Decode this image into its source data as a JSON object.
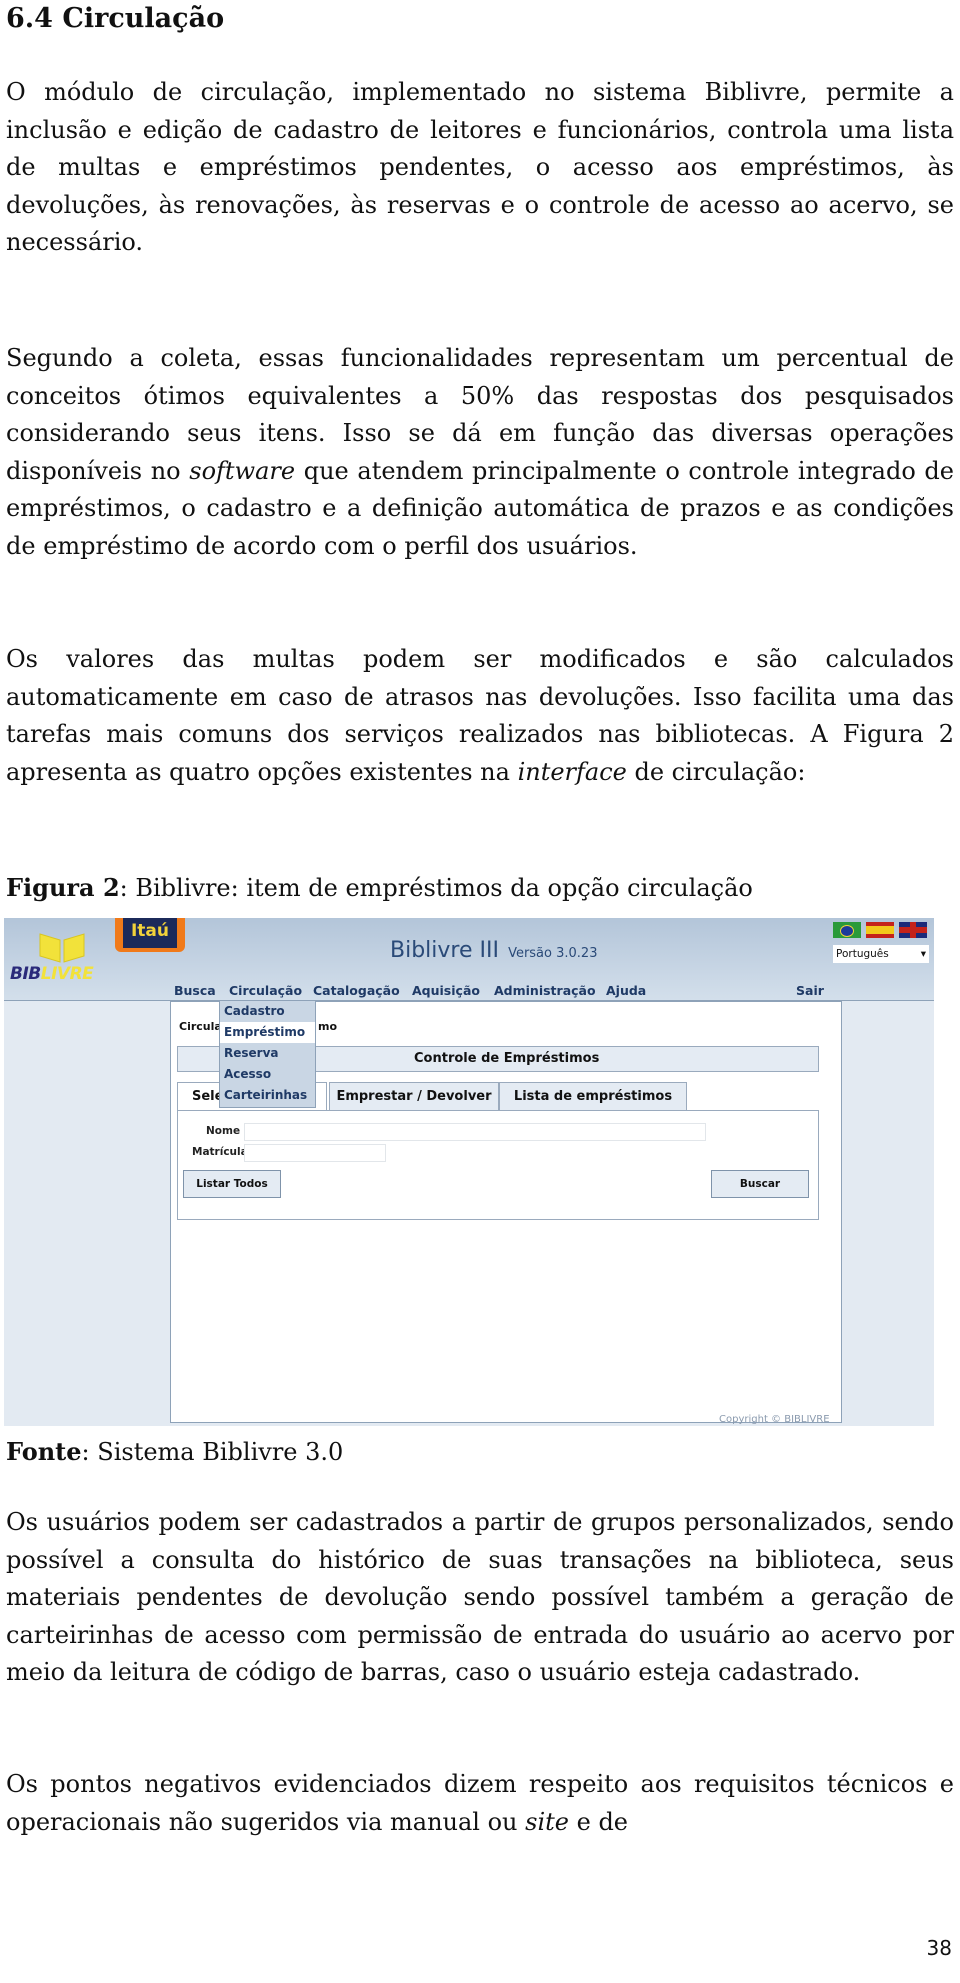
{
  "section_title": "6.4 Circulação",
  "p1": "O módulo de circulação, implementado no sistema Biblivre, permite a inclusão e edição de cadastro de leitores e funcionários, controla uma lista de multas e empréstimos pendentes, o acesso aos empréstimos, às devoluções, às renovações, às reservas e o controle de acesso ao acervo, se necessário.",
  "p2": {
    "a": "Segundo a coleta, essas funcionalidades representam um percentual de conceitos ótimos equivalentes a 50% das respostas dos pesquisados considerando seus itens. Isso se dá em função das diversas operações disponíveis no ",
    "italic": "software",
    "b": " que atendem principalmente o controle integrado de empréstimos, o cadastro e a definição automática de prazos e as condições de empréstimo de acordo com o perfil dos usuários."
  },
  "p3": {
    "a": "Os valores das multas podem ser modificados e são calculados automaticamente em caso de atrasos nas devoluções. Isso facilita uma das tarefas mais comuns dos serviços realizados nas bibliotecas. A Figura 2 apresenta as quatro opções existentes na ",
    "italic": "interface",
    "b": " de circulação:"
  },
  "figure_caption": {
    "label": "Figura 2",
    "text": ": Biblivre: item de empréstimos da opção circulação"
  },
  "figure": {
    "logo_text": "BIBLIVRE",
    "sponsor": "Itaú",
    "app_title": "Biblivre III",
    "version": "Versão 3.0.23",
    "language_select": "Português",
    "flags": [
      "brazil-flag",
      "spain-flag",
      "uk-flag"
    ],
    "menu": [
      "Busca",
      "Circulação",
      "Catalogação",
      "Aquisição",
      "Administração",
      "Ajuda"
    ],
    "logout": "Sair",
    "dropdown": [
      "Cadastro",
      "Empréstimo",
      "Reserva",
      "Acesso",
      "Carteirinhas"
    ],
    "dropdown_selected": "Empréstimo",
    "breadcrumb_visible_start": "Circula",
    "breadcrumb_visible_end": "mo",
    "panel_title": "Controle de Empréstimos",
    "tabs": [
      "Sele",
      "Emprestar / Devolver",
      "Lista de empréstimos"
    ],
    "fields": {
      "name_label": "Nome",
      "id_label": "Matrícula"
    },
    "buttons": {
      "list_all": "Listar Todos",
      "search": "Buscar"
    },
    "copyright": "Copyright © BIBLIVRE"
  },
  "source": {
    "label": "Fonte",
    "text": ": Sistema Biblivre 3.0"
  },
  "p4": "Os usuários podem ser cadastrados a partir de grupos personalizados, sendo possível a consulta do histórico de suas transações na biblioteca, seus materiais pendentes de devolução sendo possível também a geração de carteirinhas de acesso com permissão de entrada do usuário ao acervo por meio da leitura de código de barras, caso o usuário esteja cadastrado.",
  "p5": {
    "a": "Os pontos negativos evidenciados dizem respeito aos requisitos técnicos e operacionais não sugeridos via manual ou ",
    "italic": "site",
    "b": " e de"
  },
  "page_number": "38"
}
